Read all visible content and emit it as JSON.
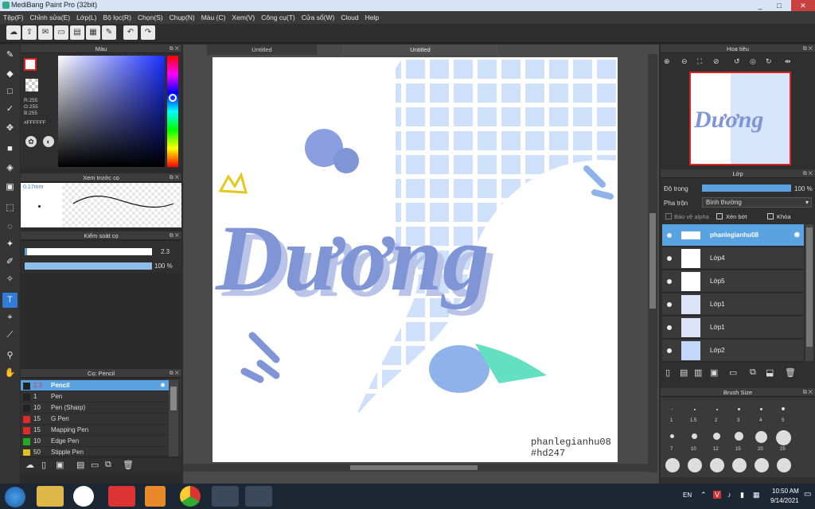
{
  "window": {
    "title": "MediBang Paint Pro (32bit)",
    "controls": [
      "_",
      "□",
      "✕"
    ]
  },
  "menu": [
    "Tệp(F)",
    "Chỉnh sửa(E)",
    "Lớp(L)",
    "Bộ lọc(R)",
    "Chọn(S)",
    "Chụp(N)",
    "Màu (C)",
    "Xem(V)",
    "Công cụ(T)",
    "Cửa sổ(W)",
    "Cloud",
    "Help"
  ],
  "color_panel": {
    "title": "Màu",
    "r": "R:255",
    "g": "G:255",
    "b": "B:255",
    "hex": "#FFFFFF"
  },
  "brush_preview": {
    "title": "Xem trước cọ",
    "size": "0.17mm"
  },
  "brush_control": {
    "title": "Kiểm soát cọ",
    "size_value": "2.3",
    "opacity_value": "100 %",
    "size_fill": 0.02,
    "opacity_fill": 1.0
  },
  "brush_list": {
    "title": "Cọ: Pencil",
    "items": [
      {
        "size": "2.3",
        "name": "Pencil",
        "color": "#222222",
        "selected": true
      },
      {
        "size": "1",
        "name": "Pen",
        "color": "#222222"
      },
      {
        "size": "10",
        "name": "Pen (Sharp)",
        "color": "#222222"
      },
      {
        "size": "15",
        "name": "G Pen",
        "color": "#e02a2a"
      },
      {
        "size": "15",
        "name": "Mapping Pen",
        "color": "#e02a2a"
      },
      {
        "size": "10",
        "name": "Edge Pen",
        "color": "#22aa22"
      },
      {
        "size": "50",
        "name": "Stipple Pen",
        "color": "#e0c020"
      }
    ]
  },
  "canvas": {
    "tabs": [
      "Untitled",
      "Untitled"
    ],
    "artwork_text": "Dương",
    "signature_1": "phanlegianhu08",
    "signature_2": "#hd247"
  },
  "navigator": {
    "title": "Hoa tiêu"
  },
  "layers": {
    "title": "Lớp",
    "opacity_label": "Độ trong",
    "opacity_value": "100 %",
    "opacity_fill": 1.0,
    "blend_label": "Pha trộn",
    "blend_value": "Bình thường",
    "protect_alpha": "Bảo vệ alpha",
    "clipping": "Xén bớt",
    "lock": "Khóa",
    "items": [
      {
        "name": "phanlegianhu08",
        "selected": true
      },
      {
        "name": "Lớp4"
      },
      {
        "name": "Lớp5"
      },
      {
        "name": "Lớp1"
      },
      {
        "name": "Lớp1"
      },
      {
        "name": "Lớp2"
      }
    ]
  },
  "brush_size": {
    "title": "Brush Size",
    "sizes": [
      "1",
      "1.5",
      "2",
      "3",
      "4",
      "5",
      "7",
      "10",
      "12",
      "15",
      "20",
      "25"
    ]
  },
  "taskbar": {
    "lang": "EN",
    "time": "10:50 AM",
    "date": "9/14/2021"
  },
  "colors": {
    "accent": "#5aa3e3",
    "art_blue": "#7f95d6",
    "grid_blue": "#cfe0fb"
  }
}
